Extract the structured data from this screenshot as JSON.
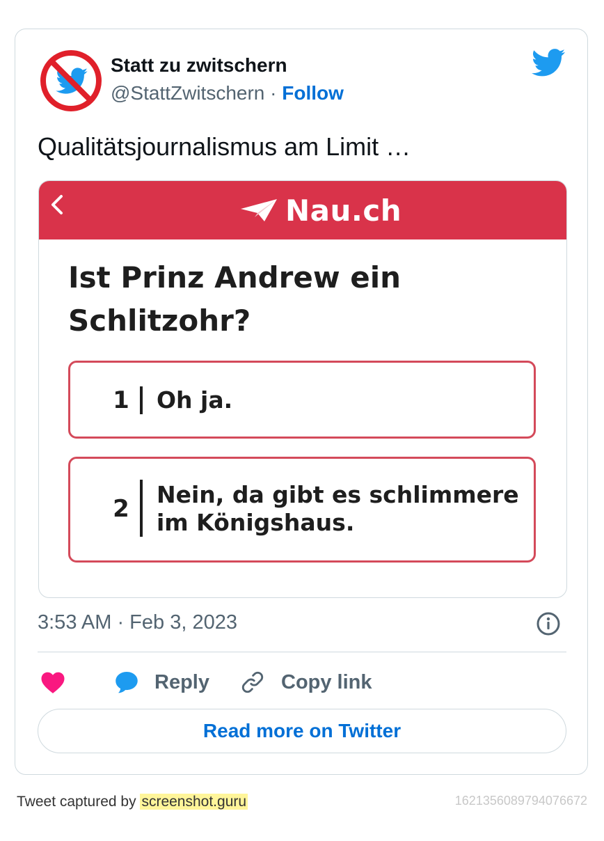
{
  "tweet": {
    "author_name": "Statt zu zwitschern",
    "handle": "@StattZwitschern",
    "separator": "·",
    "follow_label": "Follow",
    "text": "Qualitätsjournalismus am Limit …",
    "timestamp": "3:53 AM · Feb 3, 2023"
  },
  "media": {
    "brand": "Nau.ch",
    "question": "Ist Prinz Andrew ein Schlitzohr?",
    "options": [
      {
        "number": "1",
        "text": "Oh ja."
      },
      {
        "number": "2",
        "text": "Nein, da gibt es schlimmere im Königshaus."
      }
    ],
    "colors": {
      "header": "#d9334a",
      "option_border": "#d44a5a"
    }
  },
  "actions": {
    "like_icon": "heart-icon",
    "reply_label": "Reply",
    "reply_icon": "speech-bubble-icon",
    "copy_label": "Copy link",
    "copy_icon": "link-icon",
    "read_more_label": "Read more on Twitter"
  },
  "footer": {
    "captured_prefix": "Tweet captured by",
    "captured_site": "screenshot.guru",
    "tweet_id": "1621356089794076672"
  },
  "colors": {
    "accent": "#006fd6",
    "twitter_blue": "#1d9bf0",
    "like": "#f91880",
    "muted": "#536471",
    "border": "#cfd9de"
  }
}
